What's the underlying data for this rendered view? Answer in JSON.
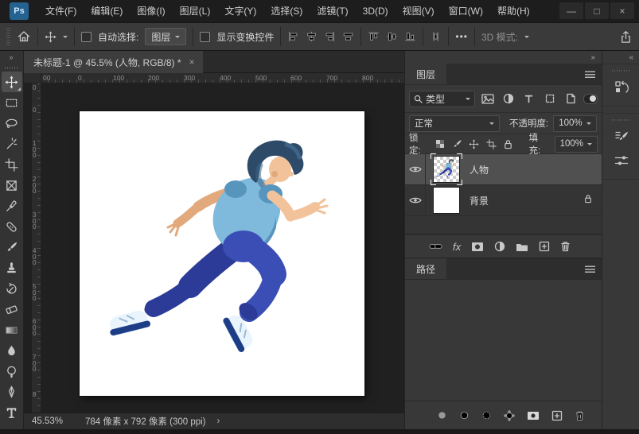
{
  "theme": {
    "winbg": "#181818",
    "menubg": "#1d1d1d",
    "menutext": "#cfcfcf",
    "barbg": "#3a3a3a",
    "toolbg": "#333333",
    "tabbarbg": "#2a2a2a",
    "tabbg": "#3d3d3d",
    "panelbg": "#383838",
    "headbg": "#2d2d2d",
    "pasteboard": "#202020",
    "canvasbg": "#ffffff",
    "text": "#d6d6d6",
    "dim": "#8f8f8f",
    "rulertext": "#8f8f8f",
    "logobg": "#25628f",
    "logotext": "#cfe8ff",
    "skin": "#f2c29b",
    "skinsh": "#e2a97d",
    "hair": "#2d4b68",
    "hairhi": "#3e6487",
    "shirt": "#7fb9dc",
    "shirtsh": "#5795bd",
    "pants": "#3a4eb5",
    "pantssh": "#2c3b97",
    "shoe": "#e9f4fc",
    "shoesh": "#c6ddf0",
    "navy": "#1d3e86"
  },
  "menu_bar": {
    "logo": "Ps",
    "items": [
      "文件(F)",
      "编辑(E)",
      "图像(I)",
      "图层(L)",
      "文字(Y)",
      "选择(S)",
      "滤镜(T)",
      "3D(D)",
      "视图(V)",
      "窗口(W)",
      "帮助(H)"
    ]
  },
  "window_controls": {
    "minimize": "—",
    "maximize": "□",
    "close": "×"
  },
  "options_bar": {
    "auto_select_label": "自动选择:",
    "auto_select_value": "图层",
    "show_transform_label": "显示变换控件",
    "mode3d_label": "3D 模式:"
  },
  "icons": {
    "more": "•••",
    "collapse_right": "»",
    "collapse_left": "«",
    "status_chevron": "›"
  },
  "document": {
    "tab_title": "未标题-1 @ 45.5% (人物, RGB/8) *",
    "close": "×",
    "ruler_top": [
      "00",
      "0",
      "100",
      "200",
      "300",
      "400",
      "500",
      "600",
      "700",
      "800"
    ],
    "ruler_left": [
      "00",
      "0",
      "100",
      "200",
      "300",
      "400",
      "500",
      "600",
      "700",
      "8"
    ],
    "status_zoom": "45.53%",
    "status_info": "784 像素 x 792 像素 (300 ppi)"
  },
  "tools": {
    "selected": "move",
    "names": [
      "move",
      "rectangular-marquee",
      "lasso",
      "magic-wand",
      "crop",
      "frame",
      "eyedropper",
      "spot-healing-brush",
      "brush",
      "clone-stamp",
      "history-brush",
      "eraser",
      "gradient",
      "blur",
      "dodge",
      "pen",
      "type"
    ]
  },
  "layers_panel": {
    "tab": "图层",
    "search_value": "类型",
    "blend_mode": "正常",
    "opacity_label": "不透明度:",
    "opacity_value": "100%",
    "lock_label": "锁定:",
    "fill_label": "填充:",
    "fill_value": "100%",
    "fx_label": "fx",
    "layers": [
      {
        "name": "人物",
        "visible": true,
        "selected": true
      },
      {
        "name": "背景",
        "visible": true,
        "locked": true
      }
    ]
  },
  "paths_panel": {
    "tab": "路径"
  },
  "canvas": {
    "artwork": "3D 跑步人物插画 — running person, blue shirt and pants, white background"
  }
}
